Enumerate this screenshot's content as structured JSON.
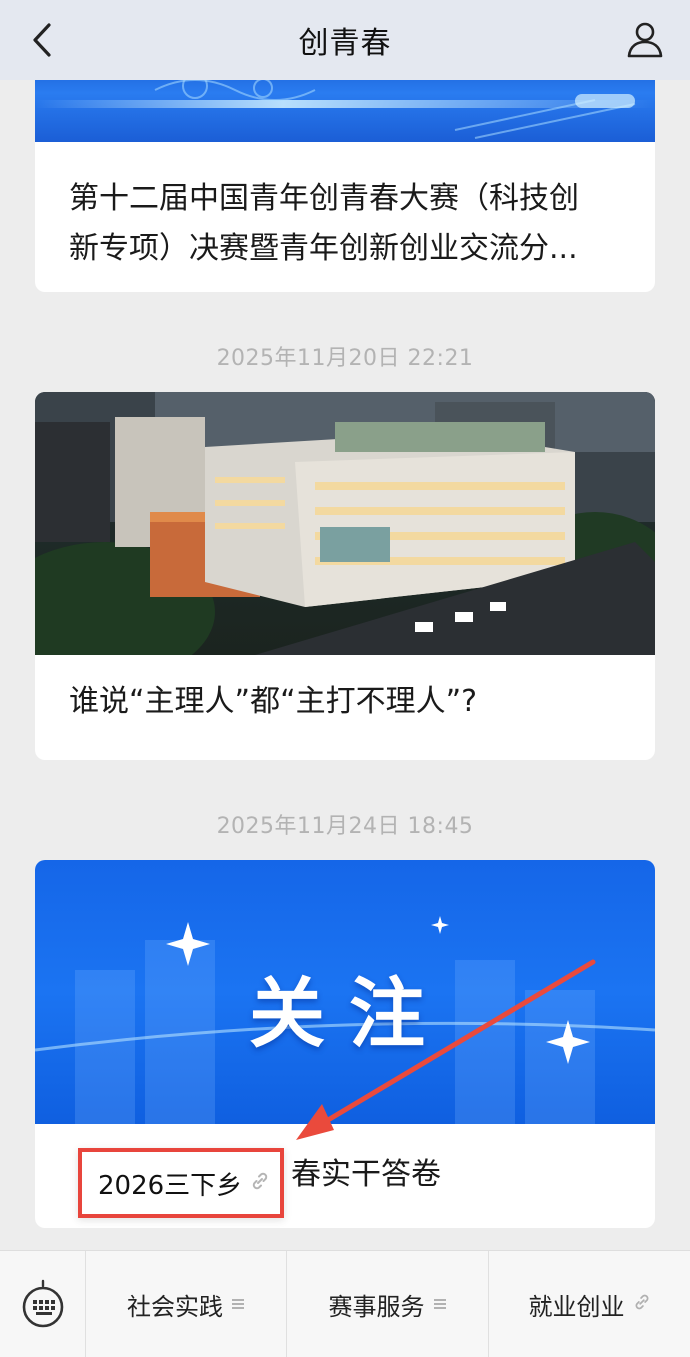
{
  "header": {
    "title": "创青春",
    "back_icon": "chevron-left-icon",
    "profile_icon": "person-icon"
  },
  "feed": [
    {
      "title_line1": "第十二届中国青年创青春大赛（科技创",
      "title_line2": "新专项）决赛暨青年创新创业交流分..."
    },
    {
      "timestamp": "2025年11月20日 22:21",
      "title": "谁说“主理人”都“主打不理人”?"
    },
    {
      "timestamp": "2025年11月24日 18:45",
      "banner_text": "关注",
      "title_visible": "春实干答卷"
    }
  ],
  "tooltip": {
    "label": "2026三下乡",
    "icon": "link-icon"
  },
  "bottom_bar": {
    "keyboard_icon": "keyboard-icon",
    "items": [
      {
        "label": "社会实践",
        "icon": "menu-lines-icon"
      },
      {
        "label": "赛事服务",
        "icon": "menu-lines-icon"
      },
      {
        "label": "就业创业",
        "icon": "link-icon"
      }
    ]
  },
  "colors": {
    "header_bg": "#e4e8f0",
    "page_bg": "#ededed",
    "highlight_red": "#e8453c",
    "banner_blue": "#1b74f2"
  }
}
